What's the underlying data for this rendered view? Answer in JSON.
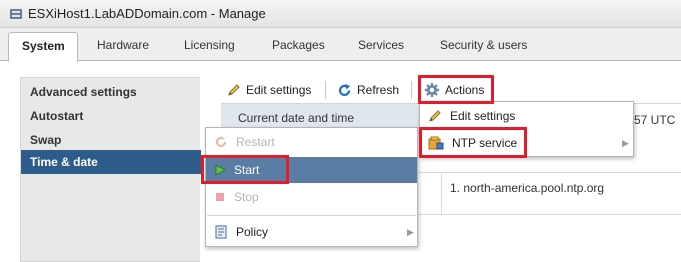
{
  "window": {
    "title": "ESXiHost1.LabADDomain.com - Manage"
  },
  "tabs": [
    {
      "label": "System",
      "active": true
    },
    {
      "label": "Hardware"
    },
    {
      "label": "Licensing"
    },
    {
      "label": "Packages"
    },
    {
      "label": "Services"
    },
    {
      "label": "Security & users"
    }
  ],
  "sidebar": {
    "items": [
      {
        "label": "Advanced settings"
      },
      {
        "label": "Autostart"
      },
      {
        "label": "Swap"
      },
      {
        "label": "Time & date",
        "active": true
      }
    ]
  },
  "toolbar": {
    "edit_settings": "Edit settings",
    "refresh": "Refresh",
    "actions": "Actions"
  },
  "table": {
    "header": "Current date and time",
    "time_suffix": "57 UTC",
    "ntp_server": "1. north-america.pool.ntp.org"
  },
  "actions_menu": {
    "edit_settings": "Edit settings",
    "ntp_service": "NTP service"
  },
  "ntp_submenu": {
    "restart": "Restart",
    "start": "Start",
    "stop": "Stop",
    "policy": "Policy"
  },
  "colors": {
    "nav_active": "#2e5c8a",
    "menu_highlight": "#5a7da4",
    "annotation_red": "#e21b2d"
  }
}
